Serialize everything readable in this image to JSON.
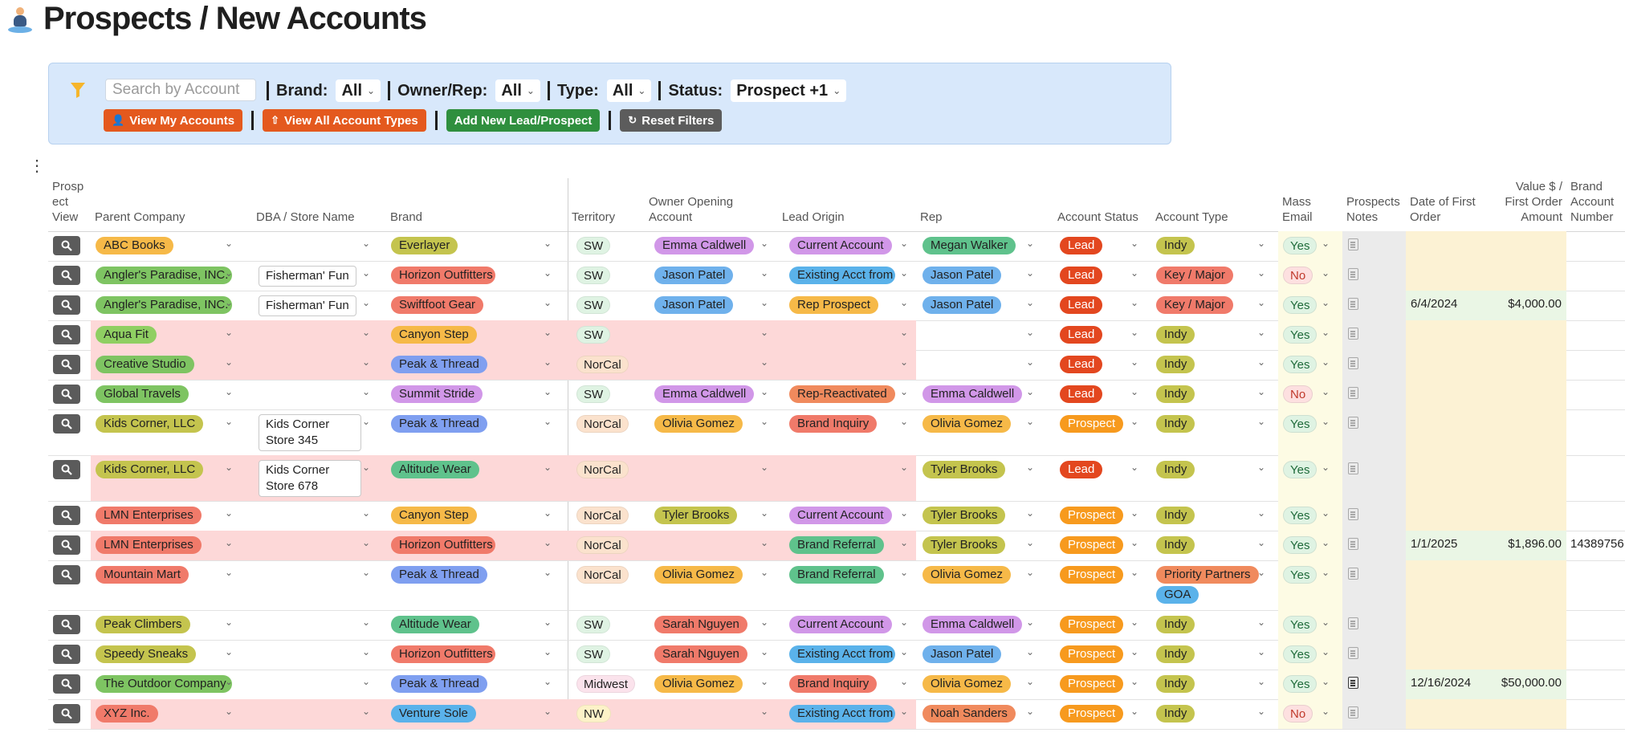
{
  "page": {
    "title": "Prospects / New Accounts"
  },
  "filters": {
    "search_placeholder": "Search by Account",
    "brand": {
      "label": "Brand:",
      "value": "All"
    },
    "owner": {
      "label": "Owner/Rep:",
      "value": "All"
    },
    "type": {
      "label": "Type:",
      "value": "All"
    },
    "status": {
      "label": "Status:",
      "value": "Prospect +1"
    },
    "buttons": {
      "my_accounts": "View My Accounts",
      "all_types": "View All Account Types",
      "add_new": "Add New Lead/Prospect",
      "reset": "Reset Filters"
    }
  },
  "columns": {
    "view": "Prosp ect View",
    "parent": "Parent Company",
    "dba": "DBA / Store Name",
    "brand": "Brand",
    "territory": "Territory",
    "owner": "Owner Opening Account",
    "lead": "Lead Origin",
    "rep": "Rep",
    "status": "Account Status",
    "type": "Account Type",
    "mass": "Mass Email",
    "notes": "Prospects Notes",
    "date": "Date of First Order",
    "value": "Value $ / First Order Amount",
    "bran": "Brand Account Number"
  },
  "rows": [
    {
      "parent": "ABC Books",
      "dba": "",
      "brand": "Everlayer",
      "territory": "SW",
      "owner": "Emma Caldwell",
      "lead": "Current Account",
      "rep": "Megan Walker",
      "status": "Lead",
      "type": [
        "Indy"
      ],
      "mass": "Yes",
      "date": "",
      "value": "",
      "bran": ""
    },
    {
      "parent": "Angler's Paradise, INC.",
      "dba": "Fisherman' Fun",
      "brand": "Horizon Outfitters",
      "territory": "SW",
      "owner": "Jason Patel",
      "lead": "Existing Acct from",
      "rep": "Jason Patel",
      "status": "Lead",
      "type": [
        "Key / Major"
      ],
      "mass": "No",
      "date": "",
      "value": "",
      "bran": ""
    },
    {
      "parent": "Angler's Paradise, INC.",
      "dba": "Fisherman' Fun",
      "brand": "Swiftfoot Gear",
      "territory": "SW",
      "owner": "Jason Patel",
      "lead": "Rep Prospect",
      "rep": "Jason Patel",
      "status": "Lead",
      "type": [
        "Key / Major"
      ],
      "mass": "Yes",
      "date": "6/4/2024",
      "value": "$4,000.00",
      "bran": ""
    },
    {
      "parent": "Aqua Fit",
      "dba": "",
      "brand": "Canyon Step",
      "territory": "SW",
      "owner": "",
      "lead": "",
      "rep": "",
      "status": "Lead",
      "type": [
        "Indy"
      ],
      "mass": "Yes",
      "date": "",
      "value": "",
      "bran": ""
    },
    {
      "parent": "Creative Studio",
      "dba": "",
      "brand": "Peak & Thread",
      "territory": "NorCal",
      "owner": "",
      "lead": "",
      "rep": "",
      "status": "Lead",
      "type": [
        "Indy"
      ],
      "mass": "Yes",
      "date": "",
      "value": "",
      "bran": ""
    },
    {
      "parent": "Global Travels",
      "dba": "",
      "brand": "Summit Stride",
      "territory": "SW",
      "owner": "Emma Caldwell",
      "lead": "Rep-Reactivated",
      "rep": "Emma Caldwell",
      "status": "Lead",
      "type": [
        "Indy"
      ],
      "mass": "No",
      "date": "",
      "value": "",
      "bran": ""
    },
    {
      "parent": "Kids Corner, LLC",
      "dba": "Kids Corner Store 345",
      "brand": "Peak & Thread",
      "territory": "NorCal",
      "owner": "Olivia Gomez",
      "lead": "Brand Inquiry",
      "rep": "Olivia Gomez",
      "status": "Prospect",
      "type": [
        "Indy"
      ],
      "mass": "Yes",
      "date": "",
      "value": "",
      "bran": ""
    },
    {
      "parent": "Kids Corner, LLC",
      "dba": "Kids Corner Store 678",
      "brand": "Altitude Wear",
      "territory": "NorCal",
      "owner": "",
      "lead": "",
      "rep": "Tyler Brooks",
      "status": "Lead",
      "type": [
        "Indy"
      ],
      "mass": "Yes",
      "date": "",
      "value": "",
      "bran": ""
    },
    {
      "parent": "LMN Enterprises",
      "dba": "",
      "brand": "Canyon Step",
      "territory": "NorCal",
      "owner": "Tyler Brooks",
      "lead": "Current Account",
      "rep": "Tyler Brooks",
      "status": "Prospect",
      "type": [
        "Indy"
      ],
      "mass": "Yes",
      "date": "",
      "value": "",
      "bran": ""
    },
    {
      "parent": "LMN Enterprises",
      "dba": "",
      "brand": "Horizon Outfitters",
      "territory": "NorCal",
      "owner": "",
      "lead": "Brand Referral",
      "rep": "Tyler Brooks",
      "status": "Prospect",
      "type": [
        "Indy"
      ],
      "mass": "Yes",
      "date": "1/1/2025",
      "value": "$1,896.00",
      "bran": "14389756"
    },
    {
      "parent": "Mountain Mart",
      "dba": "",
      "brand": "Peak & Thread",
      "territory": "NorCal",
      "owner": "Olivia Gomez",
      "lead": "Brand Referral",
      "rep": "Olivia Gomez",
      "status": "Prospect",
      "type": [
        "Priority Partners",
        "GOA"
      ],
      "mass": "Yes",
      "date": "",
      "value": "",
      "bran": ""
    },
    {
      "parent": "Peak Climbers",
      "dba": "",
      "brand": "Altitude Wear",
      "territory": "SW",
      "owner": "Sarah Nguyen",
      "lead": "Current Account",
      "rep": "Emma Caldwell",
      "status": "Prospect",
      "type": [
        "Indy"
      ],
      "mass": "Yes",
      "date": "",
      "value": "",
      "bran": ""
    },
    {
      "parent": "Speedy Sneaks",
      "dba": "",
      "brand": "Horizon Outfitters",
      "territory": "SW",
      "owner": "Sarah Nguyen",
      "lead": "Existing Acct from",
      "rep": "Jason Patel",
      "status": "Prospect",
      "type": [
        "Indy"
      ],
      "mass": "Yes",
      "date": "",
      "value": "",
      "bran": ""
    },
    {
      "parent": "The Outdoor Company",
      "dba": "",
      "brand": "Peak & Thread",
      "territory": "Midwest",
      "owner": "Olivia Gomez",
      "lead": "Brand Inquiry",
      "rep": "Olivia Gomez",
      "status": "Prospect",
      "type": [
        "Indy"
      ],
      "mass": "Yes",
      "date": "12/16/2024",
      "value": "$50,000.00",
      "bran": ""
    },
    {
      "parent": "XYZ Inc.",
      "dba": "",
      "brand": "Venture Sole",
      "territory": "NW",
      "owner": "",
      "lead": "Existing Acct from",
      "rep": "Noah Sanders",
      "status": "Prospect",
      "type": [
        "Indy"
      ],
      "mass": "No",
      "date": "",
      "value": "",
      "bran": ""
    }
  ],
  "colors": {
    "parent": {
      "ABC Books": "#f6b948",
      "Angler's Paradise, INC.": "#7ec462",
      "Aqua Fit": "#8fcf62",
      "Creative Studio": "#7ec462",
      "Global Travels": "#7ec462",
      "Kids Corner, LLC": "#c4c44e",
      "LMN Enterprises": "#f07a6a",
      "Mountain Mart": "#f07a6a",
      "Peak Climbers": "#c4c44e",
      "Speedy Sneaks": "#c4c44e",
      "The Outdoor Company": "#7ec462",
      "XYZ Inc.": "#f07a6a"
    },
    "brand": {
      "Everlayer": "#c4c44e",
      "Horizon Outfitters": "#f07a6a",
      "Swiftfoot Gear": "#f07a6a",
      "Canyon Step": "#f6b948",
      "Peak & Thread": "#7f9ff0",
      "Summit Stride": "#d197e8",
      "Altitude Wear": "#5fc28c",
      "Venture Sole": "#5ab2ea"
    },
    "territory": {
      "SW": "#dff3e3",
      "NorCal": "#fbe2cd",
      "Midwest": "#fbe3ec",
      "NW": "#fdf2c8"
    },
    "people": {
      "Emma Caldwell": "#d197e8",
      "Jason Patel": "#6fb1ec",
      "Olivia Gomez": "#f6b948",
      "Tyler Brooks": "#c4c44e",
      "Sarah Nguyen": "#f07a6a",
      "Megan Walker": "#5fc28c",
      "Noah Sanders": "#f08a5d"
    },
    "lead": {
      "Current Account": "#d197e8",
      "Existing Acct from": "#5ab2ea",
      "Rep Prospect": "#f6b948",
      "Rep-Reactivated": "#f08a5d",
      "Brand Inquiry": "#f07a6a",
      "Brand Referral": "#5fc28c"
    },
    "status": {
      "Lead": "#e3471f",
      "Prospect": "#f79a1e"
    },
    "type": {
      "Indy": "#c4c44e",
      "Key / Major": "#f07a6a",
      "Priority Partners": "#f08a5d",
      "GOA": "#5ab2ea"
    },
    "mass": {
      "Yes": "#dff3e3",
      "No": "#fde0e0"
    },
    "row_highlight": "#fdd8d8",
    "mass_bg": "#fdfbe4",
    "notes_bg": "#ebebeb",
    "date_bg": "#fcf2d4",
    "date_filled_bg": "#eaf6e5"
  },
  "icons": {
    "title": "person-icon",
    "filter": "funnel-icon",
    "view": "magnifier-icon",
    "menu": "kebab-icon",
    "chevron": "chevron-down-icon",
    "notes": "notes-icon",
    "user": "user-icon",
    "upload": "upload-icon",
    "reset": "refresh-icon"
  }
}
